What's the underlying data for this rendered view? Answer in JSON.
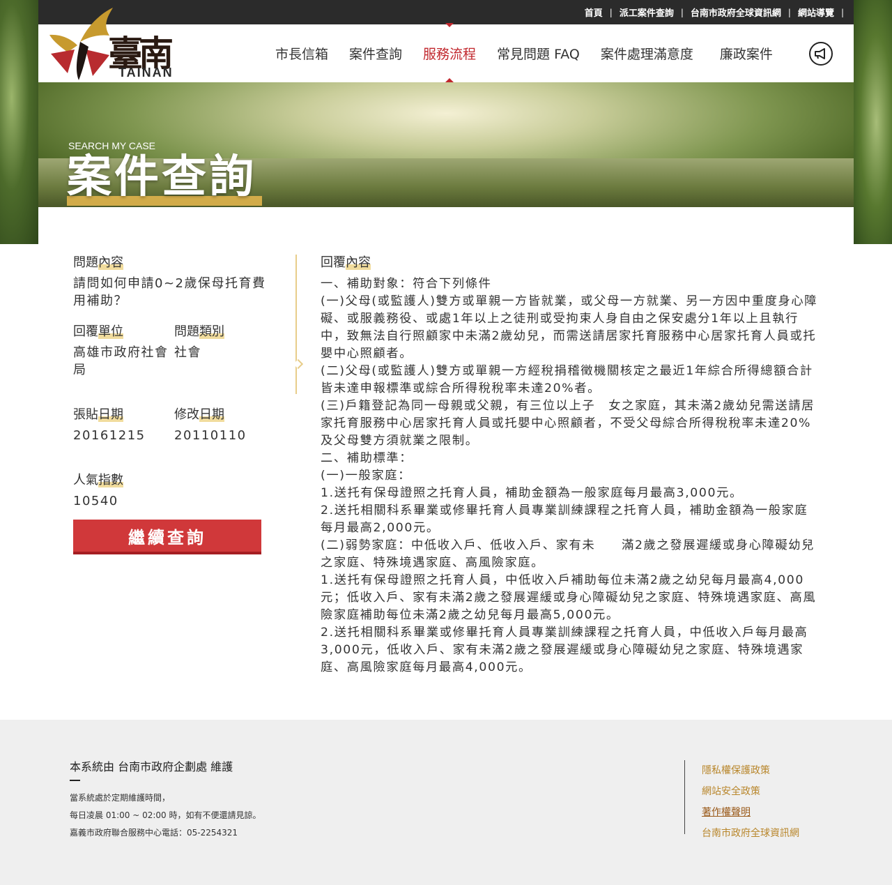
{
  "topbar": {
    "links": [
      "首頁",
      "派工案件查詢",
      "台南市政府全球資訊網",
      "網站導覽"
    ]
  },
  "logo": {
    "cn": "臺南",
    "en": "TAINAN"
  },
  "nav": {
    "items": [
      "市長信箱",
      "案件查詢",
      "服務流程",
      "常見問題 FAQ",
      "案件處理滿意度",
      "廉政案件"
    ],
    "active": "服務流程"
  },
  "banner": {
    "subtitle": "SEARCH MY CASE",
    "title": "案件查詢"
  },
  "case": {
    "question_label": "問題內容",
    "question": "請問如何申請0~2歲保母托育費用補助？",
    "unit_label": "回覆單位",
    "unit": "高雄市政府社會局",
    "category_label": "問題類別",
    "category": "社會",
    "post_date_label": "張貼日期",
    "post_date": "20161215",
    "modify_date_label": "修改日期",
    "modify_date": "20110110",
    "views_label": "人氣指數",
    "views": "10540",
    "continue_button": "繼續查詢"
  },
  "reply": {
    "label": "回覆內容",
    "text": "一、補助對象：符合下列條件\n(一)父母(或監護人)雙方或單親一方皆就業，或父母一方就業、另一方因中重度身心障礙、或服義務役、或處1年以上之徒刑或受拘束人身自由之保安處分1年以上且執行中，致無法自行照顧家中未滿2歲幼兒，而需送請居家托育服務中心居家托育人員或托嬰中心照顧者。\n(二)父母(或監護人)雙方或單親一方經稅捐稽徵機關核定之最近1年綜合所得總額合計皆未達申報標準或綜合所得稅稅率未達20%者。\n(三)戶籍登記為同一母親或父親，有三位以上子　女之家庭，其未滿2歲幼兒需送請居家托育服務中心居家托育人員或托嬰中心照顧者，不受父母綜合所得稅稅率未達20%及父母雙方須就業之限制。\n二、補助標準：\n(一)一般家庭：\n1.送托有保母證照之托育人員，補助金額為一般家庭每月最高3,000元。\n2.送托相關科系畢業或修畢托育人員專業訓練課程之托育人員，補助金額為一般家庭每月最高2,000元。\n(二)弱勢家庭：中低收入戶、低收入戶、家有未　　滿2歲之發展遲緩或身心障礙幼兒之家庭、特殊境遇家庭、高風險家庭。\n1.送托有保母證照之托育人員，中低收入戶補助每位未滿2歲之幼兒每月最高4,000元；低收入戶、家有未滿2歲之發展遲緩或身心障礙幼兒之家庭、特殊境遇家庭、高風險家庭補助每位未滿2歲之幼兒每月最高5,000元。\n2.送托相關科系畢業或修畢托育人員專業訓練課程之托育人員，中低收入戶每月最高3,000元，低收入戶、家有未滿2歲之發展遲緩或身心障礙幼兒之家庭、特殊境遇家庭、高風險家庭每月最高4,000元。"
  },
  "footer": {
    "maintainer": "本系統由 台南市政府企劃處 維護",
    "note1": "當系統處於定期維護時間，",
    "note2": "每日凌晨 01:00 ~ 02:00 時，如有不便還請見諒。",
    "note3": "嘉義市政府聯合服務中心電話：05-2254321",
    "links": [
      "隱私權保護政策",
      "網站安全政策",
      "著作權聲明",
      "台南市政府全球資訊網"
    ]
  }
}
